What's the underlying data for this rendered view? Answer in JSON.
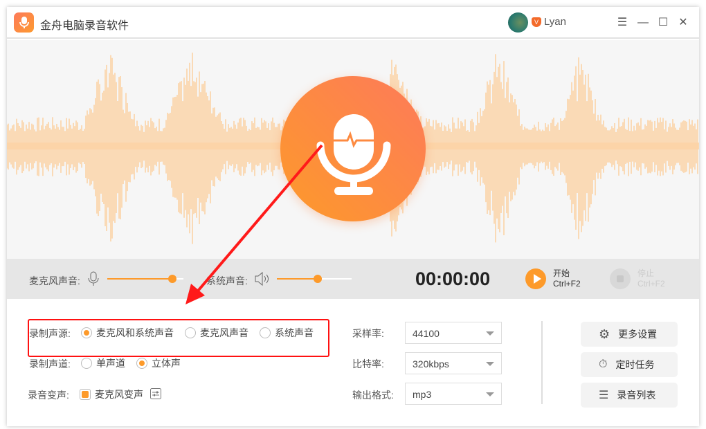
{
  "app": {
    "title": "金舟电脑录音软件",
    "user": "Lyan",
    "vip_badge": "V"
  },
  "controls": {
    "mic_label": "麦克风声音:",
    "mic_level": 0.85,
    "sys_label": "系统声音:",
    "sys_level": 0.55,
    "timer": "00:00:00",
    "start_label": "开始",
    "start_shortcut": "Ctrl+F2",
    "stop_label": "停止",
    "stop_shortcut": "Ctrl+F2"
  },
  "settings": {
    "source_label": "录制声源:",
    "source_options": [
      "麦克风和系统声音",
      "麦克风声音",
      "系统声音"
    ],
    "source_selected": 0,
    "channel_label": "录制声道:",
    "channel_options": [
      "单声道",
      "立体声"
    ],
    "channel_selected": 1,
    "voice_label": "录音变声:",
    "voice_option": "麦克风变声",
    "voice_checked": true,
    "sample_label": "采样率:",
    "sample_value": "44100",
    "bitrate_label": "比特率:",
    "bitrate_value": "320kbps",
    "format_label": "输出格式:",
    "format_value": "mp3"
  },
  "actions": {
    "more": "更多设置",
    "timer": "定时任务",
    "list": "录音列表"
  },
  "colors": {
    "accent": "#fd9a2a",
    "annotation": "#ff1a1a"
  }
}
